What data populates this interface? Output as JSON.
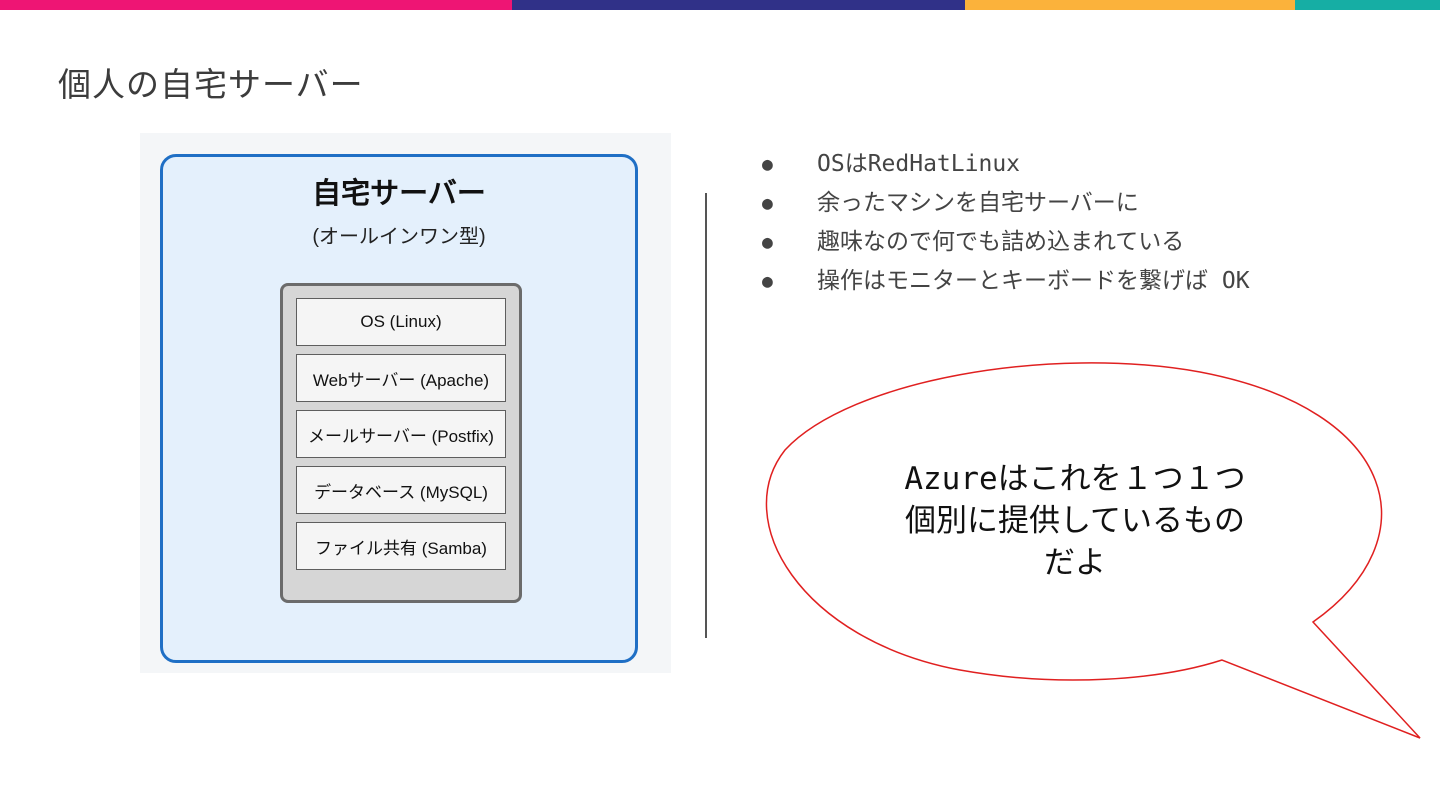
{
  "colors": {
    "topbar": [
      "#ee1574",
      "#303188",
      "#fbb23b",
      "#16aea4"
    ],
    "server_border": "#1f6fc5",
    "server_fill": "#e4f0fc",
    "bubble_stroke": "#e02020"
  },
  "title": "個人の自宅サーバー",
  "diagram": {
    "server_title": "自宅サーバー",
    "server_subtitle": "(オールインワン型)",
    "layers": [
      "OS (Linux)",
      "Webサーバー (Apache)",
      "メールサーバー (Postfix)",
      "データベース (MySQL)",
      "ファイル共有 (Samba)"
    ]
  },
  "bullets": [
    "OSはRedHatLinux",
    "余ったマシンを自宅サーバーに",
    "趣味なので何でも詰め込まれている",
    "操作はモニターとキーボードを繋げば OK"
  ],
  "bullet_marker": "●",
  "bubble": {
    "lines": [
      "Azureはこれを１つ１つ",
      "個別に提供しているもの",
      "だよ"
    ]
  }
}
